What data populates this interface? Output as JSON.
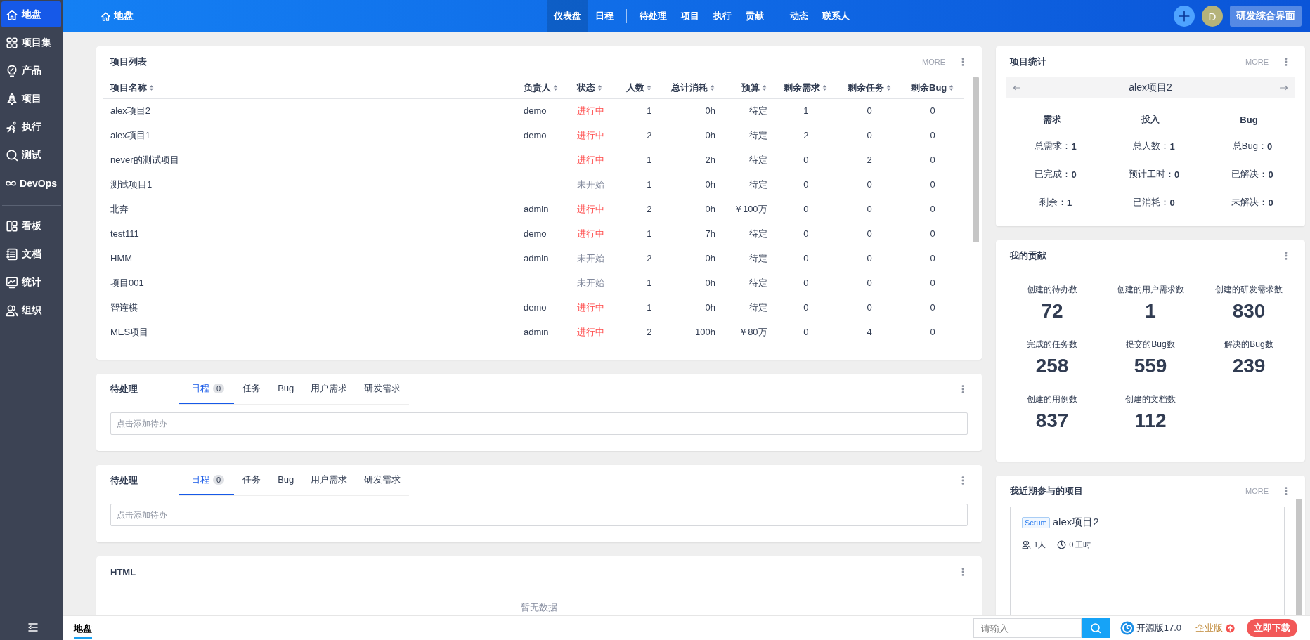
{
  "sidebar": {
    "groups": [
      [
        {
          "label": "地盘",
          "selected": true
        },
        {
          "label": "项目集",
          "selected": false
        },
        {
          "label": "产品",
          "selected": false
        },
        {
          "label": "项目",
          "selected": false
        },
        {
          "label": "执行",
          "selected": false
        },
        {
          "label": "测试",
          "selected": false
        },
        {
          "label": "DevOps",
          "selected": false
        }
      ],
      [
        {
          "label": "看板",
          "selected": false
        },
        {
          "label": "文档",
          "selected": false
        },
        {
          "label": "统计",
          "selected": false
        },
        {
          "label": "组织",
          "selected": false
        }
      ]
    ]
  },
  "topbar": {
    "breadcrumb": "地盘",
    "nav_groups": [
      [
        {
          "label": "仪表盘",
          "selected": true
        },
        {
          "label": "日程",
          "selected": false
        }
      ],
      [
        {
          "label": "待处理",
          "selected": false
        },
        {
          "label": "项目",
          "selected": false
        },
        {
          "label": "执行",
          "selected": false
        },
        {
          "label": "贡献",
          "selected": false
        }
      ],
      [
        {
          "label": "动态",
          "selected": false
        },
        {
          "label": "联系人",
          "selected": false
        }
      ]
    ],
    "avatar": "D",
    "switch_button": "研发综合界面"
  },
  "project_list": {
    "title": "项目列表",
    "more": "MORE",
    "columns": [
      {
        "label": "项目名称"
      },
      {
        "label": "负责人"
      },
      {
        "label": "状态"
      },
      {
        "label": "人数"
      },
      {
        "label": "总计消耗"
      },
      {
        "label": "预算"
      },
      {
        "label": "剩余需求"
      },
      {
        "label": "剩余任务"
      },
      {
        "label": "剩余Bug"
      }
    ],
    "rows": [
      {
        "name": "alex项目2",
        "owner": "demo",
        "status": "进行中",
        "color": "#ff4a4a",
        "members": "1",
        "consumed": "0h",
        "budget": "待定",
        "stories": "1",
        "tasks": "0",
        "bugs": "0"
      },
      {
        "name": "alex项目1",
        "owner": "demo",
        "status": "进行中",
        "color": "#ff4a4a",
        "members": "2",
        "consumed": "0h",
        "budget": "待定",
        "stories": "2",
        "tasks": "0",
        "bugs": "0"
      },
      {
        "name": "never的测试项目",
        "owner": "",
        "status": "进行中",
        "color": "#ff4a4a",
        "members": "1",
        "consumed": "2h",
        "budget": "待定",
        "stories": "0",
        "tasks": "2",
        "bugs": "0"
      },
      {
        "name": "测试项目1",
        "owner": "",
        "status": "未开始",
        "color": "#838a9d",
        "members": "1",
        "consumed": "0h",
        "budget": "待定",
        "stories": "0",
        "tasks": "0",
        "bugs": "0"
      },
      {
        "name": "北奔",
        "owner": "admin",
        "status": "进行中",
        "color": "#ff4a4a",
        "members": "2",
        "consumed": "0h",
        "budget": "￥100万",
        "stories": "0",
        "tasks": "0",
        "bugs": "0"
      },
      {
        "name": "test111",
        "owner": "demo",
        "status": "进行中",
        "color": "#ff4a4a",
        "members": "1",
        "consumed": "7h",
        "budget": "待定",
        "stories": "0",
        "tasks": "0",
        "bugs": "0"
      },
      {
        "name": "HMM",
        "owner": "admin",
        "status": "未开始",
        "color": "#838a9d",
        "members": "2",
        "consumed": "0h",
        "budget": "待定",
        "stories": "0",
        "tasks": "0",
        "bugs": "0"
      },
      {
        "name": "项目001",
        "owner": "",
        "status": "未开始",
        "color": "#838a9d",
        "members": "1",
        "consumed": "0h",
        "budget": "待定",
        "stories": "0",
        "tasks": "0",
        "bugs": "0"
      },
      {
        "name": "智连棋",
        "owner": "demo",
        "status": "进行中",
        "color": "#ff4a4a",
        "members": "1",
        "consumed": "0h",
        "budget": "待定",
        "stories": "0",
        "tasks": "0",
        "bugs": "0"
      },
      {
        "name": "MES项目",
        "owner": "admin",
        "status": "进行中",
        "color": "#ff4a4a",
        "members": "2",
        "consumed": "100h",
        "budget": "￥80万",
        "stories": "0",
        "tasks": "4",
        "bugs": "0"
      }
    ]
  },
  "todo_panels": [
    {
      "title": "待处理",
      "tabs": [
        {
          "label": "日程",
          "count": "0",
          "selected": true
        },
        {
          "label": "任务",
          "selected": false
        },
        {
          "label": "Bug",
          "selected": false
        },
        {
          "label": "用户需求",
          "selected": false
        },
        {
          "label": "研发需求",
          "selected": false
        }
      ],
      "placeholder": "点击添加待办"
    },
    {
      "title": "待处理",
      "tabs": [
        {
          "label": "日程",
          "count": "0",
          "selected": true
        },
        {
          "label": "任务",
          "selected": false
        },
        {
          "label": "Bug",
          "selected": false
        },
        {
          "label": "用户需求",
          "selected": false
        },
        {
          "label": "研发需求",
          "selected": false
        }
      ],
      "placeholder": "点击添加待办"
    }
  ],
  "html_panel": {
    "title": "HTML",
    "empty": "暂无数据"
  },
  "project_stats": {
    "title": "项目统计",
    "more": "MORE",
    "project": "alex项目2",
    "columns": [
      {
        "heading": "需求",
        "rows": [
          {
            "label": "总需求：",
            "value": "1"
          },
          {
            "label": "已完成：",
            "value": "0"
          },
          {
            "label": "剩余：",
            "value": "1"
          }
        ]
      },
      {
        "heading": "投入",
        "rows": [
          {
            "label": "总人数：",
            "value": "1"
          },
          {
            "label": "预计工时：",
            "value": "0"
          },
          {
            "label": "已消耗：",
            "value": "0"
          }
        ]
      },
      {
        "heading": "Bug",
        "rows": [
          {
            "label": "总Bug：",
            "value": "0"
          },
          {
            "label": "已解决：",
            "value": "0"
          },
          {
            "label": "未解决：",
            "value": "0"
          }
        ]
      }
    ]
  },
  "contribution": {
    "title": "我的贡献",
    "items": [
      {
        "label": "创建的待办数",
        "value": "72"
      },
      {
        "label": "创建的用户需求数",
        "value": "1"
      },
      {
        "label": "创建的研发需求数",
        "value": "830"
      },
      {
        "label": "完成的任务数",
        "value": "258"
      },
      {
        "label": "提交的Bug数",
        "value": "559"
      },
      {
        "label": "解决的Bug数",
        "value": "239"
      },
      {
        "label": "创建的用例数",
        "value": "837"
      },
      {
        "label": "创建的文档数",
        "value": "112"
      }
    ]
  },
  "recent_projects": {
    "title": "我近期参与的项目",
    "more": "MORE",
    "projects": [
      {
        "type": "Scrum",
        "name": "alex项目2",
        "members": "1人",
        "hours": "0 工时"
      }
    ]
  },
  "footer": {
    "tabs": [
      {
        "label": "地盘",
        "selected": true
      }
    ],
    "search_placeholder": "请输入",
    "version": "开源版17.0",
    "enterprise": "企业版",
    "download": "立即下载"
  }
}
